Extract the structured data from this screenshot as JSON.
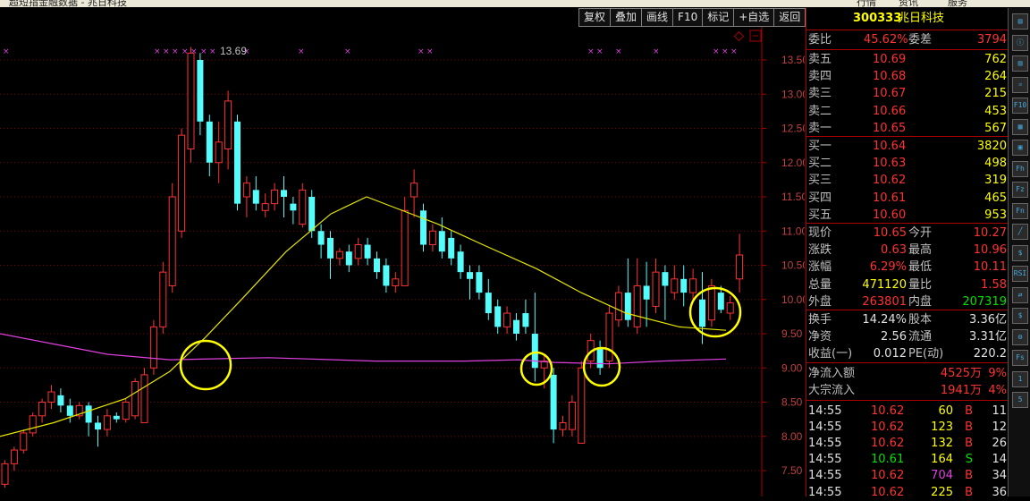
{
  "window_title": "超短指金融数据 - 兆日科技",
  "menu": [
    "行情",
    "资讯",
    "服务"
  ],
  "toolbar": [
    "复权",
    "叠加",
    "画线",
    "F10",
    "标记",
    "+自选",
    "返回"
  ],
  "header": {
    "code": "300333",
    "name": "兆日科技"
  },
  "chart": {
    "ytick_labels": [
      "13.50",
      "13.00",
      "12.50",
      "12.00",
      "11.50",
      "11.00",
      "10.50",
      "10.00",
      "9.50",
      "9.00",
      "8.50",
      "8.00",
      "7.50"
    ],
    "peak_label": "13.69",
    "colors": {
      "up": "#ff3232",
      "down": "#54fcfc",
      "ma_short": "#e6e600",
      "ma_long": "#e040e0",
      "circle": "#ffff00",
      "marker": "#e040e0"
    }
  },
  "orderbook": {
    "weibi": {
      "label": "委比",
      "value": "45.62%",
      "label2": "委差",
      "value2": "3794"
    },
    "sell": [
      {
        "label": "卖五",
        "price": "10.69",
        "vol": "762"
      },
      {
        "label": "卖四",
        "price": "10.68",
        "vol": "264"
      },
      {
        "label": "卖三",
        "price": "10.67",
        "vol": "215"
      },
      {
        "label": "卖二",
        "price": "10.66",
        "vol": "453"
      },
      {
        "label": "卖一",
        "price": "10.65",
        "vol": "567"
      }
    ],
    "buy": [
      {
        "label": "买一",
        "price": "10.64",
        "vol": "3820"
      },
      {
        "label": "买二",
        "price": "10.63",
        "vol": "498"
      },
      {
        "label": "买三",
        "price": "10.62",
        "vol": "319"
      },
      {
        "label": "买四",
        "price": "10.61",
        "vol": "465"
      },
      {
        "label": "买五",
        "price": "10.60",
        "vol": "953"
      }
    ]
  },
  "quote": [
    {
      "l1": "现价",
      "v1": "10.65",
      "l2": "今开",
      "v2": "10.27"
    },
    {
      "l1": "涨跌",
      "v1": "0.63",
      "l2": "最高",
      "v2": "10.96"
    },
    {
      "l1": "涨幅",
      "v1": "6.29%",
      "l2": "最低",
      "v2": "10.11"
    },
    {
      "l1": "总量",
      "v1": "471120",
      "l2": "量比",
      "v2": "1.58"
    },
    {
      "l1": "外盘",
      "v1": "263801",
      "l2": "内盘",
      "v2": "207319"
    }
  ],
  "fundamentals": [
    {
      "l1": "换手",
      "v1": "14.24%",
      "l2": "股本",
      "v2": "3.36亿"
    },
    {
      "l1": "净资",
      "v1": "2.56",
      "l2": "流通",
      "v2": "3.31亿"
    },
    {
      "l1": "收益(一)",
      "v1": "0.012",
      "l2": "PE(动)",
      "v2": "220.2"
    }
  ],
  "flows": [
    {
      "label": "净流入额",
      "value": "4525万",
      "pct": "9%"
    },
    {
      "label": "大宗流入",
      "value": "1941万",
      "pct": "4%"
    }
  ],
  "ticks": [
    {
      "time": "14:55",
      "price": "10.62",
      "vol": "60",
      "side": "B",
      "n": "11"
    },
    {
      "time": "14:55",
      "price": "10.62",
      "vol": "123",
      "side": "B",
      "n": "12"
    },
    {
      "time": "14:55",
      "price": "10.62",
      "vol": "132",
      "side": "B",
      "n": "26"
    },
    {
      "time": "14:55",
      "price": "10.61",
      "vol": "164",
      "side": "S",
      "n": "14"
    },
    {
      "time": "14:55",
      "price": "10.62",
      "vol": "704",
      "side": "B",
      "n": "34"
    },
    {
      "time": "14:55",
      "price": "10.62",
      "vol": "225",
      "side": "B",
      "n": "36"
    }
  ],
  "sidebar_icons": [
    "bar-chart",
    "info",
    "stats",
    "time-share",
    "f10",
    "rank",
    "doc",
    "fh",
    "fz",
    "fund",
    "line",
    "security",
    "rsi",
    "switch",
    "dollar",
    "settings",
    "fs",
    "one",
    "five"
  ],
  "sidebar_labels": [
    "F5",
    "1",
    "5"
  ]
}
